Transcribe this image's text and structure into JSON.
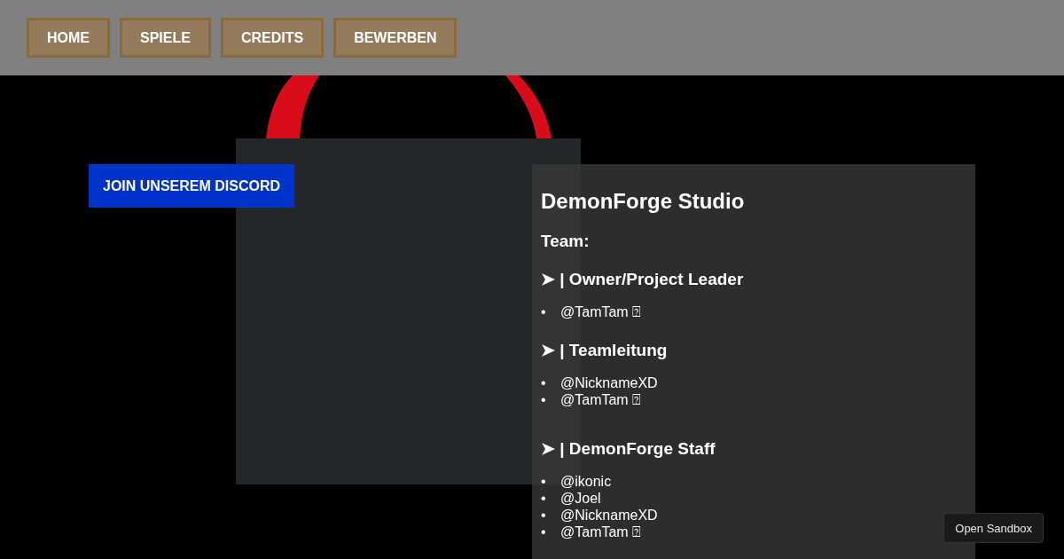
{
  "nav": [
    {
      "label": "HOME"
    },
    {
      "label": "SPIELE"
    },
    {
      "label": "CREDITS"
    },
    {
      "label": "BEWERBEN"
    }
  ],
  "discord_button": "JOIN UNSEREM DISCORD",
  "panel": {
    "title": "DemonForge Studio",
    "subtitle": "Team:",
    "sections": [
      {
        "heading": "➤ | Owner/Project Leader",
        "members": [
          {
            "marker": "•",
            "name": "@TamTam ⍰"
          }
        ]
      },
      {
        "heading": "➤ | Teamleitung",
        "members": [
          {
            "marker": "•",
            "name": "@NicknameXD"
          },
          {
            "marker": "•",
            "name": "@TamTam ⍰"
          }
        ]
      },
      {
        "heading": "➤ | DemonForge Staff",
        "members": [
          {
            "marker": "•",
            "name": "@ikonic"
          },
          {
            "marker": "•",
            "name": "@Joel"
          },
          {
            "marker": "•",
            "name": "@NicknameXD"
          },
          {
            "marker": "•",
            "name": "@TamTam ⍰"
          }
        ]
      }
    ]
  },
  "sandbox_button": "Open Sandbox"
}
